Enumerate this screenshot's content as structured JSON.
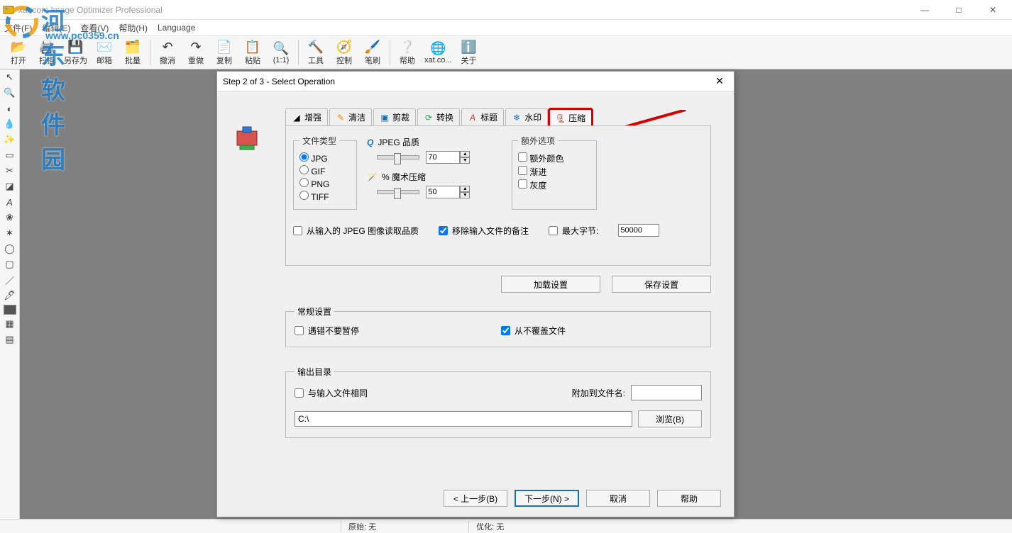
{
  "window": {
    "title": "xat.com   Image Optimizer Professional"
  },
  "menus": {
    "file": "文件(F)",
    "edit": "编辑(E)",
    "view": "查看(V)",
    "help_m": "帮助(H)",
    "language": "Language"
  },
  "toolbar": {
    "open": "打开",
    "scan": "扫描",
    "saveas": "另存为",
    "mail": "邮箱",
    "batch": "批量",
    "undo": "撤消",
    "redo": "重做",
    "copy": "复制",
    "paste": "粘贴",
    "oneone": "(1:1)",
    "tools": "工具",
    "control": "控制",
    "brush": "笔刷",
    "help": "帮助",
    "xat": "xat.co...",
    "about": "关于"
  },
  "status": {
    "original": "原始: 无",
    "optimized": "优化: 无"
  },
  "dialog": {
    "title": "Step 2 of 3 - Select Operation",
    "tabs": {
      "enhance": "增强",
      "clean": "清洁",
      "crop": "剪裁",
      "convert": "转换",
      "title_t": "标题",
      "watermark": "水印",
      "compress": "压缩"
    },
    "filetype": {
      "legend": "文件类型",
      "jpg": "JPG",
      "gif": "GIF",
      "png": "PNG",
      "tiff": "TIFF",
      "selected": "JPG"
    },
    "jpeg": {
      "label": "JPEG 品质",
      "value": "70"
    },
    "magic": {
      "label": "% 魔术压缩",
      "value": "50"
    },
    "extra": {
      "legend": "额外选项",
      "extra_color": "额外颜色",
      "progressive": "渐进",
      "gray": "灰度"
    },
    "read_q": "从输入的 JPEG 图像读取品质",
    "strip_comments": "移除输入文件的备注",
    "max_bytes_label": "最大字节:",
    "max_bytes_value": "50000",
    "load_settings": "加载设置",
    "save_settings": "保存设置",
    "general": {
      "legend": "常规设置",
      "no_pause": "遇错不要暂停",
      "no_overwrite": "从不覆盖文件"
    },
    "output": {
      "legend": "输出目录",
      "same_as_input": "与输入文件相同",
      "append_label": "附加到文件名:",
      "append_value": "",
      "path": "C:\\",
      "browse": "浏览(B)"
    },
    "footer": {
      "back": "< 上一步(B)",
      "next": "下一步(N) >",
      "cancel": "取消",
      "help": "帮助"
    }
  },
  "watermark": {
    "text": "河东软件园",
    "url": "www.pc0359.cn"
  }
}
